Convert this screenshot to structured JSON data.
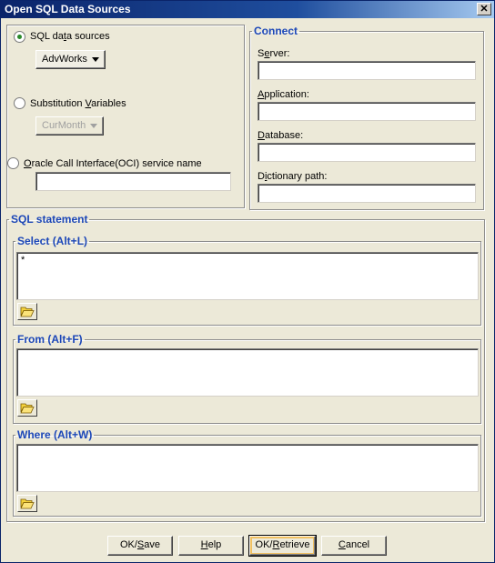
{
  "window": {
    "title": "Open SQL Data Sources",
    "close_glyph": "✕"
  },
  "sources": {
    "sql": {
      "label_pre": "SQL da",
      "label_key": "t",
      "label_post": "a sources",
      "selected": true,
      "value": "AdvWorks"
    },
    "subst": {
      "label_pre": "Substitution ",
      "label_key": "V",
      "label_post": "ariables",
      "selected": false,
      "value": "CurMonth"
    },
    "oci": {
      "label_pre": "",
      "label_key": "O",
      "label_post": "racle Call Interface(OCI) service name",
      "selected": false,
      "value": ""
    }
  },
  "connect": {
    "legend": "Connect",
    "fields": [
      {
        "label_pre": "S",
        "label_key": "e",
        "label_post": "rver:",
        "value": ""
      },
      {
        "label_pre": "",
        "label_key": "A",
        "label_post": "pplication:",
        "value": ""
      },
      {
        "label_pre": "",
        "label_key": "D",
        "label_post": "atabase:",
        "value": ""
      },
      {
        "label_pre": "D",
        "label_key": "i",
        "label_post": "ctionary path:",
        "value": ""
      }
    ]
  },
  "sql": {
    "legend": "SQL statement",
    "select": {
      "legend": "Select (Alt+L)",
      "value": "*"
    },
    "from": {
      "legend": "From (Alt+F)",
      "value": ""
    },
    "where": {
      "legend": "Where (Alt+W)",
      "value": ""
    },
    "open_icon": "open-folder-icon"
  },
  "buttons": {
    "ok_save": {
      "pre": "OK/",
      "key": "S",
      "post": "ave"
    },
    "help": {
      "pre": "",
      "key": "H",
      "post": "elp"
    },
    "ok_retrieve": {
      "pre": "OK/",
      "key": "R",
      "post": "etrieve"
    },
    "cancel": {
      "pre": "",
      "key": "C",
      "post": "ancel"
    }
  },
  "colors": {
    "title_bar": "#0a246a",
    "legend_blue": "#1c47b8",
    "dialog_bg": "#ece9d8",
    "radio_dot": "#2a8a2a"
  }
}
